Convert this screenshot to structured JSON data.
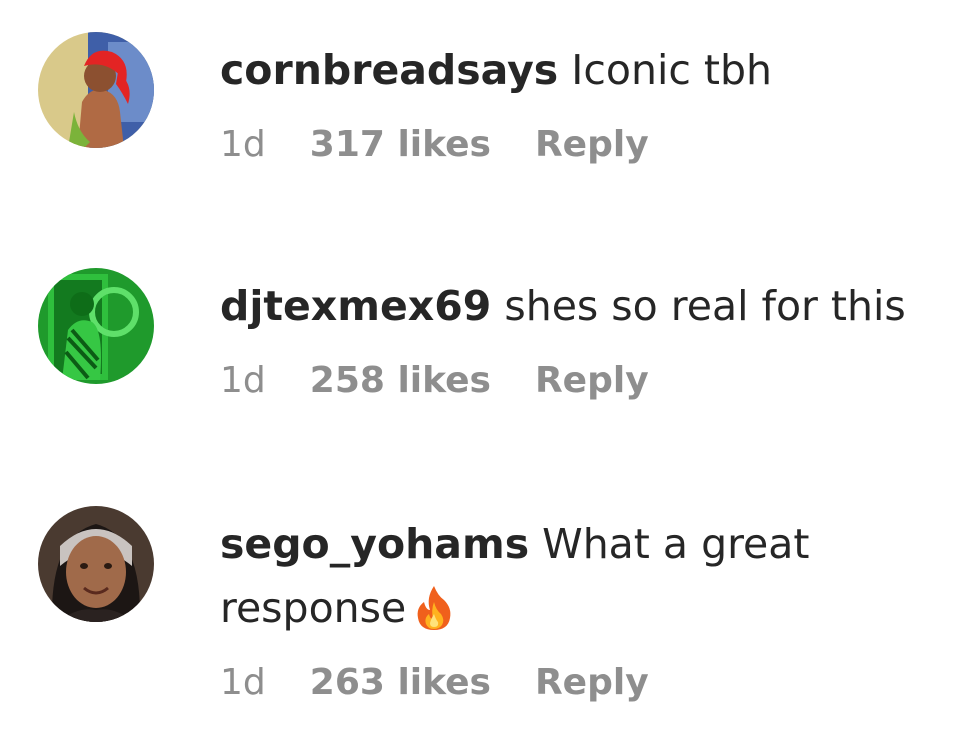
{
  "comments": [
    {
      "username": "cornbreadsays",
      "text": "Iconic tbh",
      "time": "1d",
      "likes": "317 likes",
      "reply": "Reply",
      "avatar_icon": "user-avatar-red-hair"
    },
    {
      "username": "djtexmex69",
      "text": "shes so real for this",
      "time": "1d",
      "likes": "258 likes",
      "reply": "Reply",
      "avatar_icon": "user-avatar-green-mirror-selfie"
    },
    {
      "username": "sego_yohams",
      "text": "What a great",
      "text_line2": "response",
      "emoji": "fire-icon",
      "time": "1d",
      "likes": "263 likes",
      "reply": "Reply",
      "avatar_icon": "user-avatar-portrait"
    }
  ],
  "colors": {
    "text": "#262626",
    "meta": "#8e8e8e",
    "background": "#ffffff"
  }
}
